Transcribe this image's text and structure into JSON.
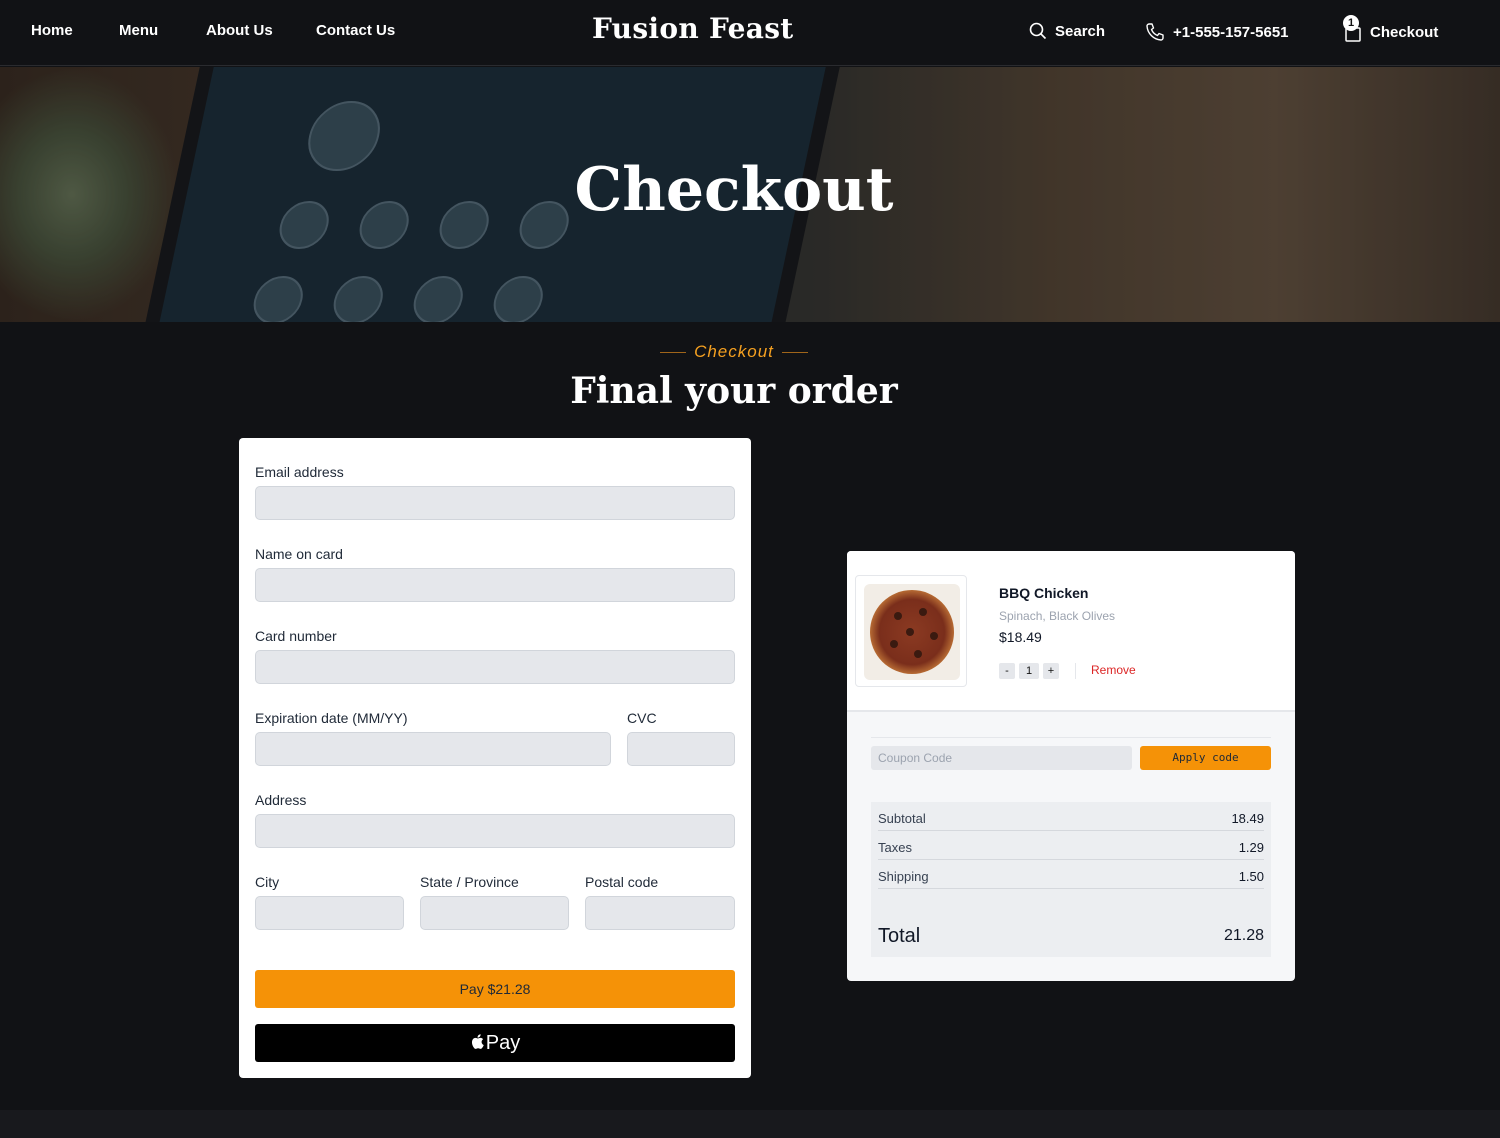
{
  "nav": {
    "links": [
      "Home",
      "Menu",
      "About Us",
      "Contact Us"
    ],
    "brand": "Fusion Feast",
    "search_label": "Search",
    "phone": "+1-555-157-5651",
    "checkout_label": "Checkout",
    "cart_count": "1"
  },
  "hero": {
    "title": "Checkout"
  },
  "section": {
    "eyebrow": "Checkout",
    "title": "Final your order"
  },
  "form": {
    "email_label": "Email address",
    "name_label": "Name on card",
    "card_label": "Card number",
    "exp_label": "Expiration date (MM/YY)",
    "cvc_label": "CVC",
    "address_label": "Address",
    "city_label": "City",
    "state_label": "State / Province",
    "postal_label": "Postal code",
    "pay_button": "Pay $21.28",
    "apple_pay_label": "Pay"
  },
  "cart": {
    "item": {
      "name": "BBQ Chicken",
      "description": "Spinach, Black Olives",
      "price": "$18.49",
      "quantity": "1",
      "decrement": "-",
      "increment": "+",
      "remove": "Remove"
    },
    "coupon_placeholder": "Coupon Code",
    "apply_button": "Apply code",
    "subtotal_label": "Subtotal",
    "subtotal": "18.49",
    "taxes_label": "Taxes",
    "taxes": "1.29",
    "shipping_label": "Shipping",
    "shipping": "1.50",
    "total_label": "Total",
    "total": "21.28"
  },
  "colors": {
    "accent": "#f59207",
    "background": "#111215",
    "remove": "#dc2626"
  }
}
